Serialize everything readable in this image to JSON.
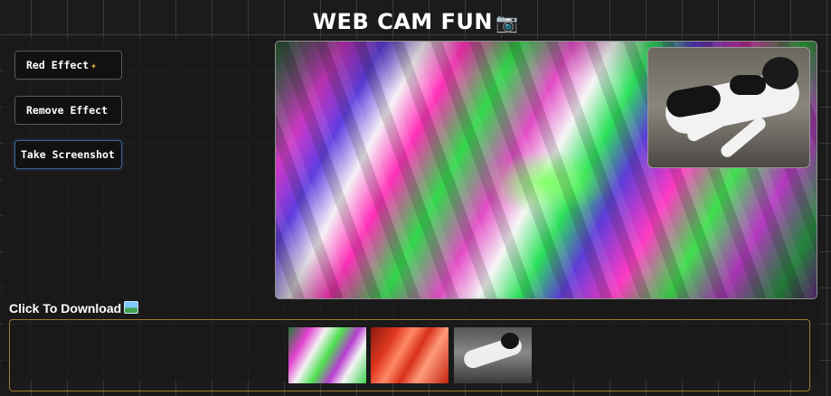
{
  "app": {
    "title": "WEB CAM FUN",
    "title_icon": "camera-icon"
  },
  "controls": {
    "red_effect_label": "Red Effect",
    "red_effect_icon": "magic-wand-icon",
    "remove_effect_label": "Remove Effect",
    "screenshot_label": "Take Screenshot"
  },
  "download": {
    "label": "Click To Download",
    "label_icon": "picture-icon",
    "thumbnails": [
      "glitch-effect-screenshot",
      "red-effect-screenshot",
      "original-screenshot"
    ]
  },
  "colors": {
    "background": "#1b1b1b",
    "gallery_border": "#a07b2a",
    "screenshot_button_border": "#3b5f95"
  }
}
